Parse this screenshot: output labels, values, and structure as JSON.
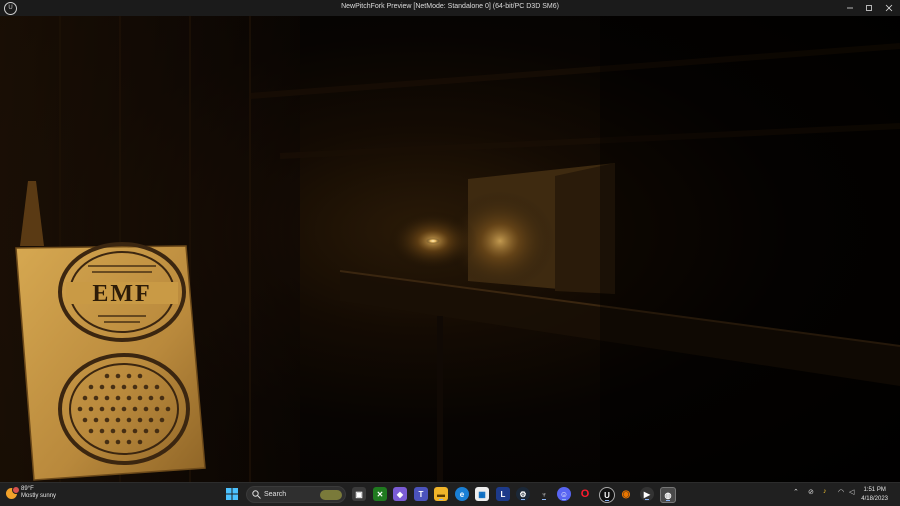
{
  "window": {
    "title": "NewPitchFork Preview [NetMode: Standalone 0]  (64-bit/PC D3D SM6)",
    "logo_text": "U"
  },
  "scene": {
    "sign_text": "EMF"
  },
  "taskbar": {
    "weather": {
      "temperature": "89°F",
      "condition": "Mostly sunny"
    },
    "search_label": "Search",
    "apps": [
      "start-icon",
      "task-view-icon",
      "xbox-icon",
      "copilot-icon",
      "teams-icon",
      "file-explorer-icon",
      "edge-icon",
      "microsoft-store-icon",
      "launcher-icon",
      "steam-icon",
      "game-icon",
      "discord-icon",
      "opera-gx-icon",
      "unreal-engine-icon",
      "blender-icon",
      "media-player-icon",
      "unreal-editor-icon"
    ],
    "clock": {
      "time": "1:51 PM",
      "date": "4/18/2023"
    }
  },
  "colors": {
    "titlebar": "#1b1b1b",
    "taskbar": "#202020",
    "sign_paper": "#c99a45",
    "warm_light": "#f6c66a"
  }
}
